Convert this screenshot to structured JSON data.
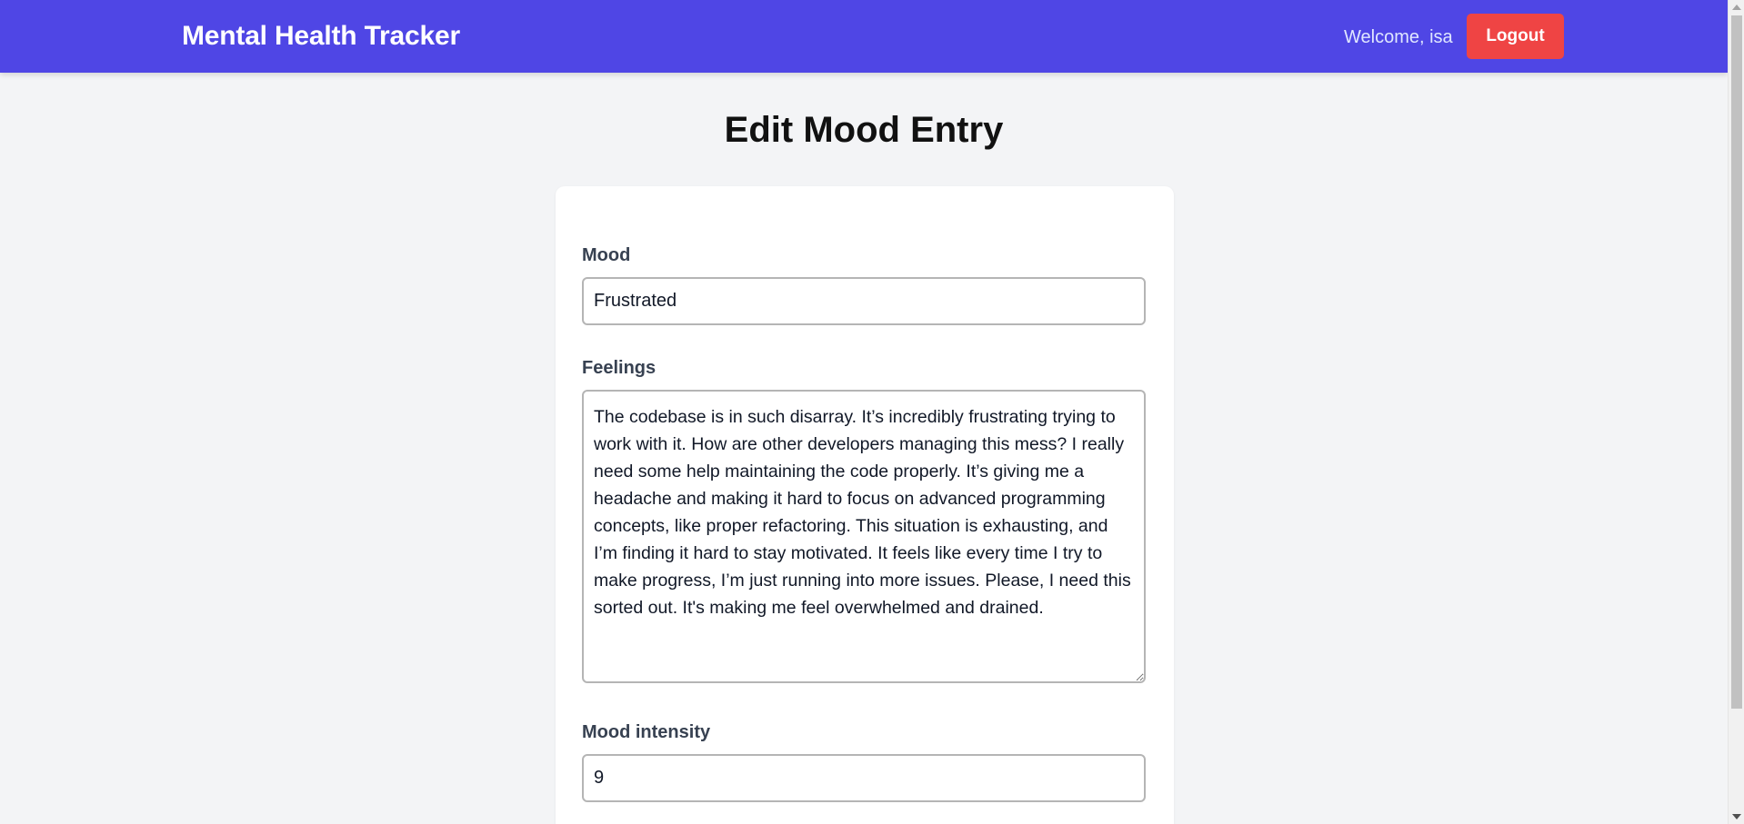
{
  "navbar": {
    "brand": "Mental Health Tracker",
    "welcome_text": "Welcome, isa",
    "logout_label": "Logout",
    "background_color": "#4f46e5",
    "logout_color": "#ef4444"
  },
  "main": {
    "title": "Edit Mood Entry"
  },
  "form": {
    "mood": {
      "label": "Mood",
      "value": "Frustrated"
    },
    "feelings": {
      "label": "Feelings",
      "value": "The codebase is in such disarray. It’s incredibly frustrating trying to work with it. How are other developers managing this mess? I really need some help maintaining the code properly. It’s giving me a headache and making it hard to focus on advanced programming concepts, like proper refactoring. This situation is exhausting, and I’m finding it hard to stay motivated. It feels like every time I try to make progress, I’m just running into more issues. Please, I need this sorted out. It's making me feel overwhelmed and drained."
    },
    "mood_intensity": {
      "label": "Mood intensity",
      "value": "9"
    }
  },
  "icons": {
    "scroll_up": "scroll-up-arrow-icon",
    "scroll_down": "scroll-down-arrow-icon"
  }
}
